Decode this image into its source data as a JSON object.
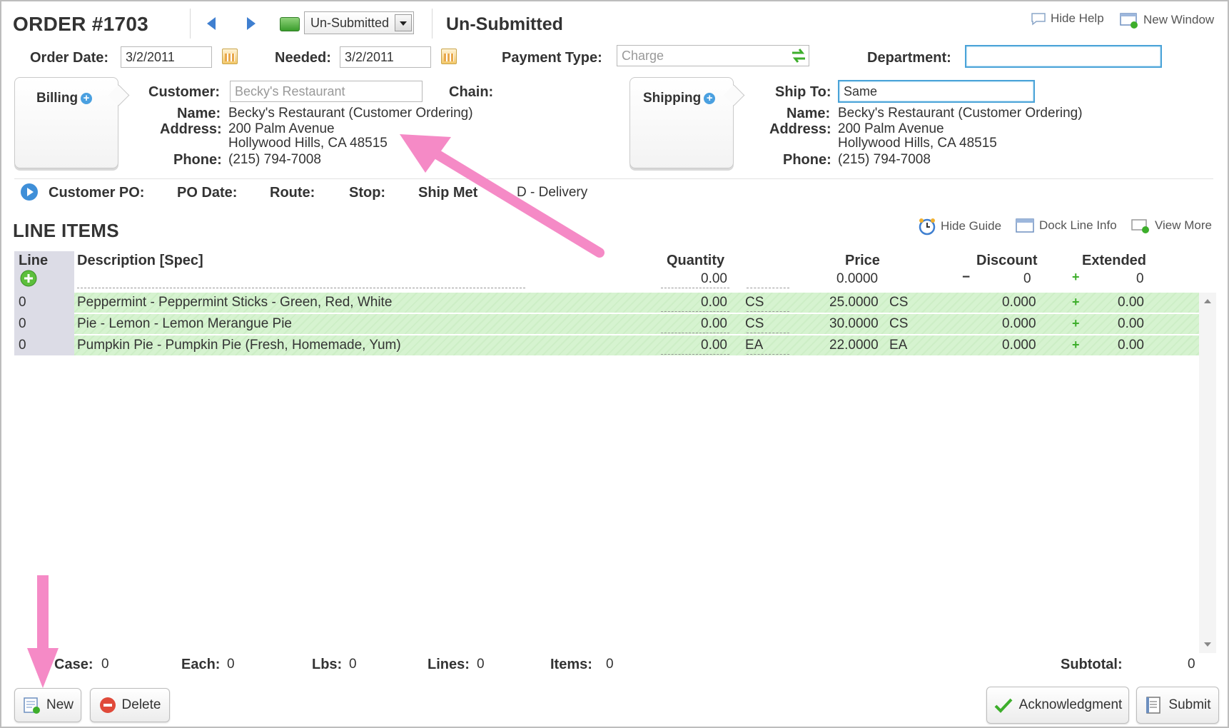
{
  "header": {
    "order_title": "ORDER #1703",
    "status_select": "Un-Submitted",
    "status_text": "Un-Submitted",
    "hide_help": "Hide Help",
    "new_window": "New Window"
  },
  "dates": {
    "order_date_label": "Order Date:",
    "order_date": "3/2/2011",
    "needed_label": "Needed:",
    "needed": "3/2/2011",
    "payment_label": "Payment Type:",
    "payment_placeholder": "Charge",
    "department_label": "Department:"
  },
  "billing": {
    "tab": "Billing",
    "customer_label": "Customer:",
    "customer_placeholder": "Becky's Restaurant",
    "chain_label": "Chain:",
    "name_label": "Name:",
    "name": "Becky's Restaurant (Customer Ordering)",
    "address_label": "Address:",
    "address1": "200 Palm Avenue",
    "address2": "Hollywood Hills, CA 48515",
    "phone_label": "Phone:",
    "phone": "(215) 794-7008"
  },
  "shipping": {
    "tab": "Shipping",
    "shipto_label": "Ship To:",
    "shipto": "Same",
    "name_label": "Name:",
    "name": "Becky's Restaurant (Customer Ordering)",
    "address_label": "Address:",
    "address1": "200 Palm Avenue",
    "address2": "Hollywood Hills, CA 48515",
    "phone_label": "Phone:",
    "phone": "(215) 794-7008"
  },
  "po": {
    "customer_po": "Customer PO:",
    "po_date": "PO Date:",
    "route": "Route:",
    "stop": "Stop:",
    "ship_method_label": "Ship Met",
    "ship_method_tail": ":",
    "ship_method": "D - Delivery"
  },
  "line_items": {
    "title": "LINE ITEMS",
    "hide_guide": "Hide Guide",
    "dock_line_info": "Dock Line Info",
    "view_more": "View More",
    "headers": {
      "line": "Line",
      "description": "Description [Spec]",
      "quantity": "Quantity",
      "price": "Price",
      "discount": "Discount",
      "extended": "Extended"
    },
    "new_row": {
      "quantity": "0.00",
      "price": "0.0000",
      "discount": "0",
      "extended": "0",
      "minus": "−",
      "plus": "+"
    },
    "rows": [
      {
        "line": "0",
        "description": "Peppermint - Peppermint Sticks - Green, Red, White",
        "quantity": "0.00",
        "unit": "CS",
        "price": "25.0000",
        "price_unit": "CS",
        "discount": "0.000",
        "plus": "+",
        "extended": "0.00"
      },
      {
        "line": "0",
        "description": "Pie - Lemon - Lemon Merangue Pie",
        "quantity": "0.00",
        "unit": "CS",
        "price": "30.0000",
        "price_unit": "CS",
        "discount": "0.000",
        "plus": "+",
        "extended": "0.00"
      },
      {
        "line": "0",
        "description": "Pumpkin Pie - Pumpkin Pie (Fresh, Homemade, Yum)",
        "quantity": "0.00",
        "unit": "EA",
        "price": "22.0000",
        "price_unit": "EA",
        "discount": "0.000",
        "plus": "+",
        "extended": "0.00"
      }
    ]
  },
  "totals": {
    "case_label": "Case:",
    "case": "0",
    "each_label": "Each:",
    "each": "0",
    "lbs_label": "Lbs:",
    "lbs": "0",
    "lines_label": "Lines:",
    "lines": "0",
    "items_label": "Items:",
    "items": "0",
    "subtotal_label": "Subtotal:",
    "subtotal": "0"
  },
  "buttons": {
    "new": "New",
    "delete": "Delete",
    "acknowledgment": "Acknowledgment",
    "submit": "Submit"
  },
  "colors": {
    "row_green": "#d6f3d0",
    "annotation_arrow": "#f58ac6",
    "focus_border": "#4aa3d8"
  }
}
